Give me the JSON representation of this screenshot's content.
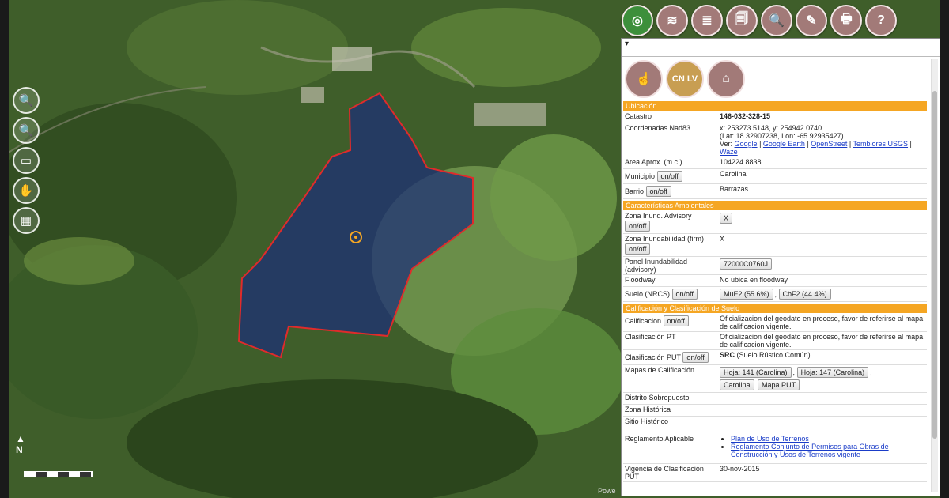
{
  "map": {
    "north_label": "N",
    "powered_text": "Powe"
  },
  "maptools": [
    {
      "name": "zoom-in-icon",
      "glyph": "🔍"
    },
    {
      "name": "zoom-out-icon",
      "glyph": "🔍"
    },
    {
      "name": "measure-icon",
      "glyph": "▭"
    },
    {
      "name": "hand-pointer-icon",
      "glyph": "✋"
    },
    {
      "name": "grid-icon",
      "glyph": "▦"
    }
  ],
  "topbar": [
    {
      "name": "map-layers-icon",
      "glyph": "◎"
    },
    {
      "name": "layers-icon",
      "glyph": "≋"
    },
    {
      "name": "basemap-icon",
      "glyph": "≣"
    },
    {
      "name": "document-search-icon",
      "glyph": "🗐"
    },
    {
      "name": "search-icon",
      "glyph": "🔍"
    },
    {
      "name": "draw-icon",
      "glyph": "✎"
    },
    {
      "name": "print-icon",
      "glyph": "🖶"
    },
    {
      "name": "help-icon",
      "glyph": "?"
    }
  ],
  "panel": {
    "collapse_glyph": "▾",
    "icons": [
      {
        "name": "hand-icon",
        "glyph": "☝",
        "label": ""
      },
      {
        "name": "cnlv-icon",
        "glyph": "",
        "label": "CN LV"
      },
      {
        "name": "house-icon",
        "glyph": "⌂",
        "label": ""
      }
    ],
    "sections": {
      "ubicacion": "Ubicación",
      "ambientales": "Características Ambientales",
      "calificacion": "Calificación y Clasificación de Suelo"
    },
    "catastro": {
      "label": "Catastro",
      "value": "146-032-328-15"
    },
    "coords": {
      "label": "Coordenadas Nad83",
      "line1": "x: 253273.5148, y: 254942.0740",
      "line2": "(Lat: 18.32907238, Lon: -65.92935427)",
      "ver": "Ver:",
      "links": [
        "Google",
        "Google Earth",
        "OpenStreet",
        "Temblores USGS",
        "Waze"
      ]
    },
    "area": {
      "label": "Area Aprox. (m.c.)",
      "value": "104224.8838"
    },
    "municipio": {
      "label": "Municipio",
      "btn": "on/off",
      "value": "Carolina"
    },
    "barrio": {
      "label": "Barrio",
      "btn": "on/off",
      "value": "Barrazas"
    },
    "zona_inund_adv": {
      "label": "Zona Inund. Advisory",
      "btn": "on/off",
      "value": "X"
    },
    "zona_inund_firm": {
      "label": "Zona Inundabilidad (firm)",
      "btn": "on/off",
      "value": "X"
    },
    "panel_inund": {
      "label": "Panel Inundabilidad (advisory)",
      "value": "72000C0760J"
    },
    "floodway": {
      "label": "Floodway",
      "value": "No ubica en floodway"
    },
    "suelo": {
      "label": "Suelo (NRCS)",
      "btn": "on/off",
      "v1": "MuE2 (55.6%)",
      "v2": "CbF2 (44.4%)"
    },
    "calificacion": {
      "label": "Calificacion",
      "btn": "on/off",
      "value": "Oficializacion del geodato en proceso, favor de referirse al mapa de calificacion vigente."
    },
    "clasificacion_pt": {
      "label": "Clasificación PT",
      "value": "Oficializacion del geodato en proceso, favor de referirse al mapa de calificacion vigente."
    },
    "clasificacion_put": {
      "label": "Clasificación PUT",
      "btn": "on/off",
      "code": "SRC",
      "desc": "(Suelo Rústico Común)"
    },
    "mapas": {
      "label": "Mapas de Calificación",
      "hoja1": "Hoja: 141 (Carolina)",
      "hoja2": "Hoja: 147 (Carolina)",
      "carolina": "Carolina",
      "mapa_put": "Mapa PUT"
    },
    "distrito": {
      "label": "Distrito Sobrepuesto"
    },
    "zona_hist": {
      "label": "Zona Histórica"
    },
    "sitio_hist": {
      "label": "Sitio Histórico"
    },
    "reglamento": {
      "label": "Reglamento Aplicable",
      "items": [
        "Plan de Uso de Terrenos",
        "Reglamento Conjunto de Permisos para Obras de Construcción y Usos de Terrenos vigente"
      ]
    },
    "vigencia": {
      "label": "Vigencia de Clasificación PUT",
      "value": "30-nov-2015"
    }
  },
  "colors": {
    "accent": "#f5a623",
    "button": "#a27a78",
    "parcel_fill": "#1c2e78",
    "parcel_stroke": "#e02b2b"
  }
}
